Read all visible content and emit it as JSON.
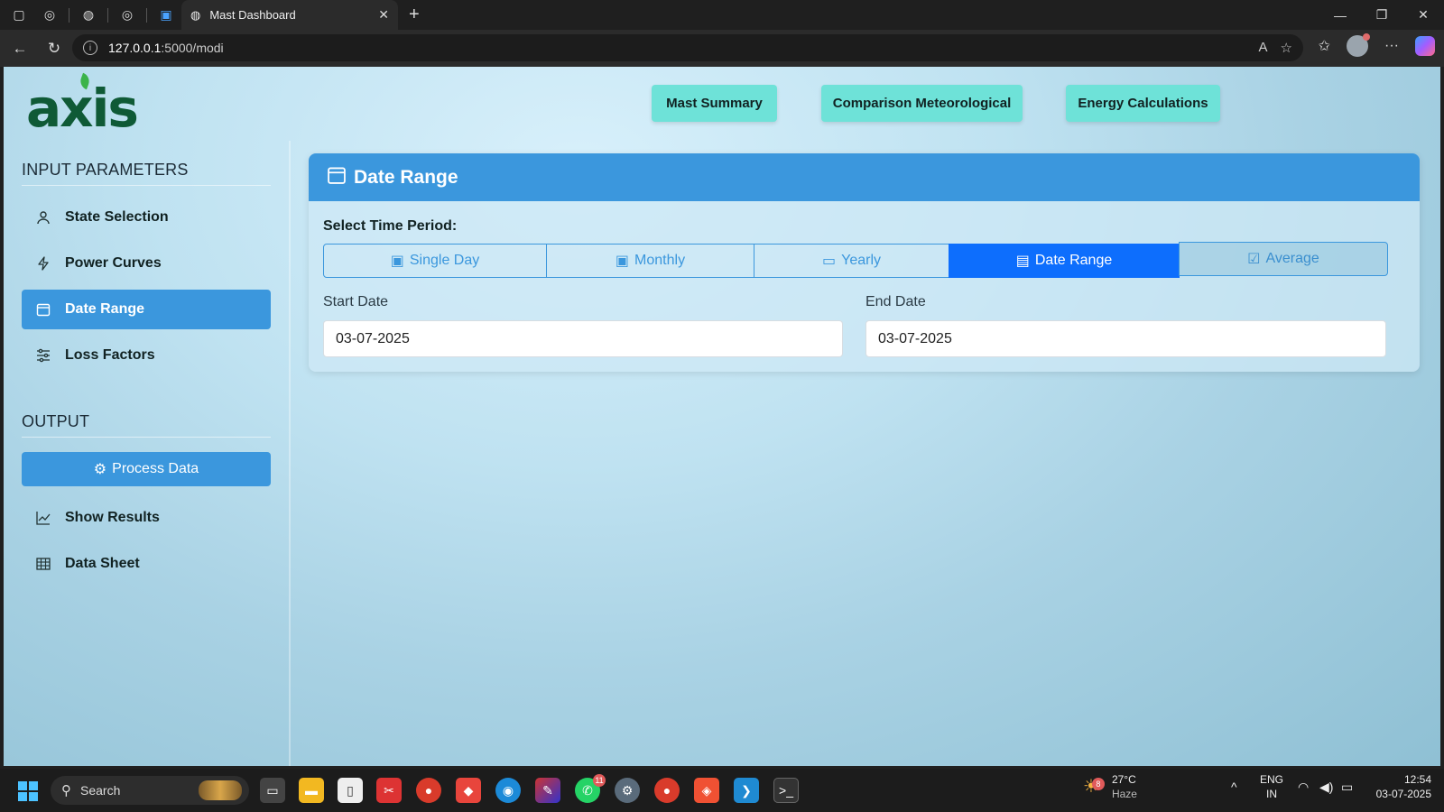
{
  "browser": {
    "tab_title": "Mast Dashboard",
    "url_host": "127.0.0.1",
    "url_rest": ":5000/modi"
  },
  "header": {
    "logo_text": "axis",
    "nav": [
      "Mast Summary",
      "Comparison Meteorological",
      "Energy Calculations"
    ]
  },
  "sidebar": {
    "input_title": "INPUT PARAMETERS",
    "items": [
      {
        "label": "State Selection",
        "icon": "person-icon"
      },
      {
        "label": "Power Curves",
        "icon": "lightning-icon"
      },
      {
        "label": "Date Range",
        "icon": "calendar-icon",
        "active": true
      },
      {
        "label": "Loss Factors",
        "icon": "sliders-icon"
      }
    ],
    "output_title": "OUTPUT",
    "process_label": "Process Data",
    "output_items": [
      {
        "label": "Show Results",
        "icon": "line-chart-icon"
      },
      {
        "label": "Data Sheet",
        "icon": "table-icon"
      }
    ]
  },
  "panel": {
    "title": "Date Range",
    "period_label": "Select Time Period:",
    "periods": [
      "Single Day",
      "Monthly",
      "Yearly",
      "Date Range",
      "Average"
    ],
    "active_period": "Date Range",
    "start_label": "Start Date",
    "start_value": "03-07-2025",
    "end_label": "End Date",
    "end_value": "03-07-2025"
  },
  "taskbar": {
    "search_label": "Search",
    "weather_temp": "27°C",
    "weather_desc": "Haze",
    "weather_badge": "8",
    "whatsapp_badge": "11",
    "lang_top": "ENG",
    "lang_bottom": "IN",
    "time": "12:54",
    "date": "03-07-2025"
  },
  "colors": {
    "accent": "#3b97dd",
    "active_segment": "#0d6efd",
    "nav_button": "#6ee2d8",
    "logo": "#0f5a36"
  }
}
